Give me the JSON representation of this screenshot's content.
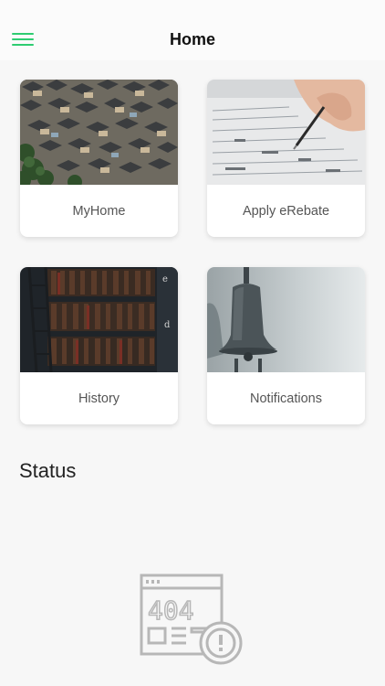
{
  "header": {
    "title": "Home",
    "menu_icon": "hamburger-menu-icon",
    "accent": "#2ecc71"
  },
  "cards": [
    {
      "label": "MyHome",
      "image": "aerial-houses-photo"
    },
    {
      "label": "Apply eRebate",
      "image": "filling-form-photo"
    },
    {
      "label": "History",
      "image": "bookshelf-photo"
    },
    {
      "label": "Notifications",
      "image": "bell-photo"
    }
  ],
  "status": {
    "title": "Status",
    "empty_state_icon": "404-page-error-icon",
    "empty_state_code": "404"
  }
}
